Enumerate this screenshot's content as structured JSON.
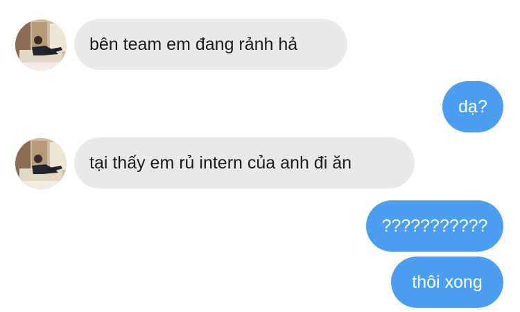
{
  "messages": [
    {
      "sender": "contact",
      "text": "bên team em đang rảnh hả"
    },
    {
      "sender": "me",
      "text": "dạ?"
    },
    {
      "sender": "contact",
      "text": "tại thấy em rủ intern của anh đi ăn"
    },
    {
      "sender": "me",
      "text": "???????????"
    },
    {
      "sender": "me",
      "text": "thôi xong"
    }
  ],
  "colors": {
    "incoming_bubble": "#e9e9eb",
    "outgoing_bubble": "#4c9ff0",
    "incoming_text": "#1c1c1e",
    "outgoing_text": "#ffffff"
  }
}
